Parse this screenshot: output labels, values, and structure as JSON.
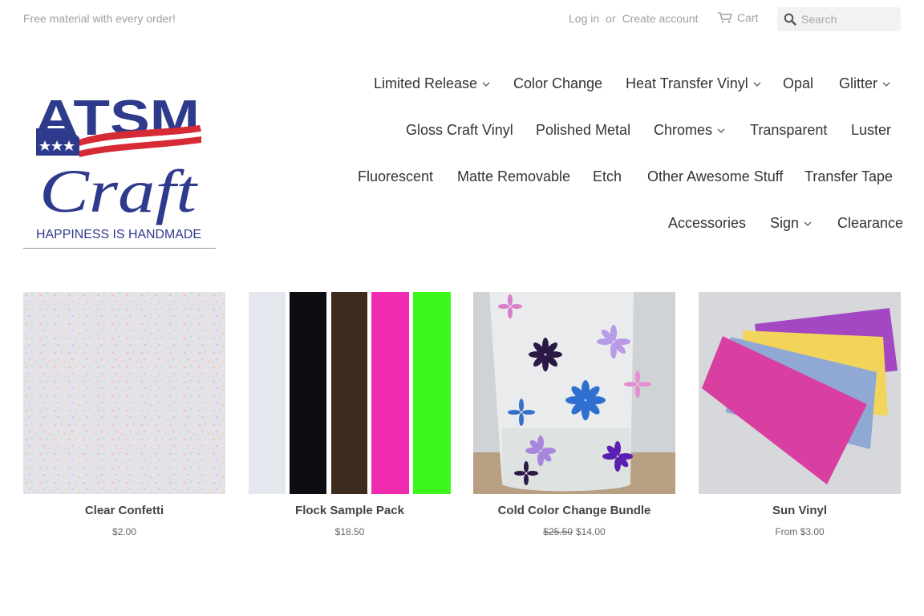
{
  "header": {
    "promo": "Free material with every order!",
    "login": "Log in",
    "or": "or",
    "create_account": "Create account",
    "cart": "Cart",
    "search_placeholder": "Search"
  },
  "logo": {
    "line1": "ATSM",
    "line2": "Craft",
    "tagline": "HAPPINESS IS HANDMADE",
    "colors": {
      "blue": "#2e3a8c",
      "red": "#d62a35"
    }
  },
  "nav": {
    "limited_release": "Limited Release",
    "color_change": "Color Change",
    "heat_transfer_vinyl": "Heat Transfer Vinyl",
    "opal": "Opal",
    "glitter": "Glitter",
    "gloss_craft_vinyl": "Gloss Craft Vinyl",
    "polished_metal": "Polished Metal",
    "chromes": "Chromes",
    "transparent": "Transparent",
    "luster": "Luster",
    "fluorescent": "Fluorescent",
    "matte_removable": "Matte Removable",
    "etch": "Etch",
    "other_awesome_stuff": "Other Awesome Stuff",
    "transfer_tape": "Transfer Tape",
    "accessories": "Accessories",
    "sign": "Sign",
    "clearance": "Clearance"
  },
  "products": [
    {
      "title": "Clear Confetti",
      "price": "$2.00"
    },
    {
      "title": "Flock Sample Pack",
      "price": "$18.50"
    },
    {
      "title": "Cold Color Change Bundle",
      "compare_price": "$25.50",
      "price": "$14.00"
    },
    {
      "title": "Sun Vinyl",
      "price": "From $3.00"
    }
  ]
}
